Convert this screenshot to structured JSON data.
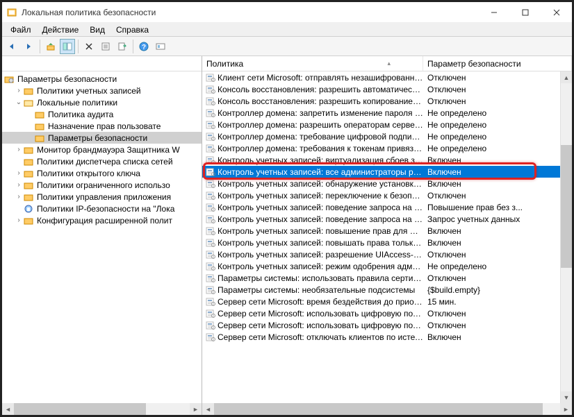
{
  "window": {
    "title": "Локальная политика безопасности"
  },
  "menu": {
    "file": "Файл",
    "action": "Действие",
    "view": "Вид",
    "help": "Справка"
  },
  "tree": {
    "root": "Параметры безопасности",
    "n1": "Политики учетных записей",
    "n2": "Локальные политики",
    "n2a": "Политика аудита",
    "n2b": "Назначение прав пользовате",
    "n2c": "Параметры безопасности",
    "n3": "Монитор брандмауэра Защитника W",
    "n4": "Политики диспетчера списка сетей",
    "n5": "Политики открытого ключа",
    "n6": "Политики ограниченного использо",
    "n7": "Политики управления приложения",
    "n8": "Политики IP-безопасности на \"Лока",
    "n9": "Конфигурация расширенной полит"
  },
  "cols": {
    "policy": "Политика",
    "setting": "Параметр безопасности"
  },
  "list": [
    {
      "name": "Клиент сети Microsoft: отправлять незашифрованный па...",
      "val": "Отключен"
    },
    {
      "name": "Консоль восстановления: разрешить автоматический вх...",
      "val": "Отключен"
    },
    {
      "name": "Консоль восстановления: разрешить копирование диске...",
      "val": "Отключен"
    },
    {
      "name": "Контроллер домена: запретить изменение пароля учетн...",
      "val": "Не определено"
    },
    {
      "name": "Контроллер домена: разрешить операторам сервера зад...",
      "val": "Не определено"
    },
    {
      "name": "Контроллер домена: требование цифровой подписи для ...",
      "val": "Не определено"
    },
    {
      "name": "Контроллер домена: требования к токенам привязки кан...",
      "val": "Не определено"
    },
    {
      "name": "Контроль учетных записей: виртуализация сбоев записи ...",
      "val": "Включен"
    },
    {
      "name": "Контроль учетных записей: все администраторы работа...",
      "val": "Включен",
      "sel": true,
      "hl": true
    },
    {
      "name": "Контроль учетных записей: обнаружение установки при...",
      "val": "Включен"
    },
    {
      "name": "Контроль учетных записей: переключение к безопасном...",
      "val": "Отключен"
    },
    {
      "name": "Контроль учетных записей: поведение запроса на повы...",
      "val": "Повышение прав без з..."
    },
    {
      "name": "Контроль учетных записей: поведение запроса на повы...",
      "val": "Запрос учетных данных"
    },
    {
      "name": "Контроль учетных записей: повышение прав для UIAcces...",
      "val": "Включен"
    },
    {
      "name": "Контроль учетных записей: повышать права только для ...",
      "val": "Включен"
    },
    {
      "name": "Контроль учетных записей: разрешение UIAccess-прило...",
      "val": "Отключен"
    },
    {
      "name": "Контроль учетных записей: режим одобрения администр...",
      "val": "Не определено"
    },
    {
      "name": "Параметры системы: использовать правила сертификат...",
      "val": "Отключен"
    },
    {
      "name": "Параметры системы: необязательные подсистемы",
      "val": "{$build.empty}"
    },
    {
      "name": "Сервер сети Microsoft: время бездействия до приостанов...",
      "val": "15 мин."
    },
    {
      "name": "Сервер сети Microsoft: использовать цифровую подпись ...",
      "val": "Отключен"
    },
    {
      "name": "Сервер сети Microsoft: использовать цифровую подпись ...",
      "val": "Отключен"
    },
    {
      "name": "Сервер сети Microsoft: отключать клиентов по истечени...",
      "val": "Включен"
    }
  ]
}
